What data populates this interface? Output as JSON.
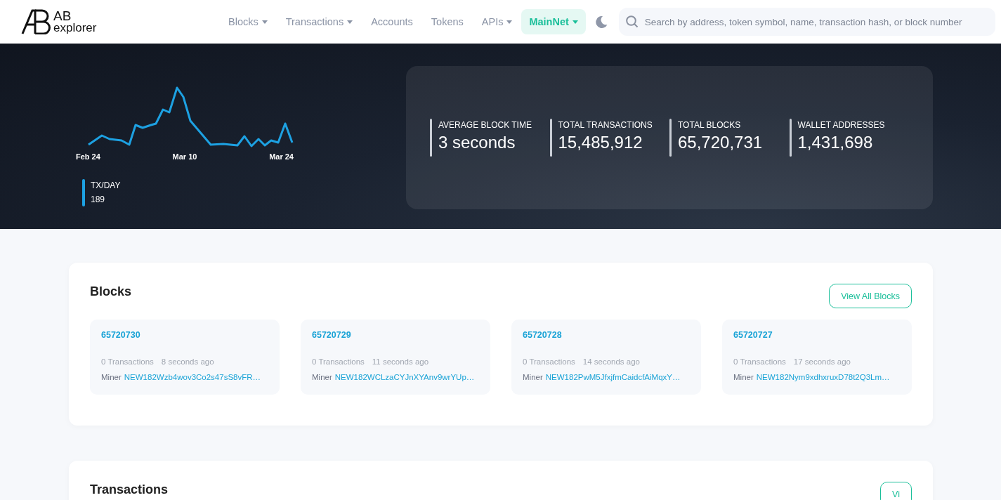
{
  "header": {
    "logo_title": "AB",
    "logo_subtitle": "explorer",
    "nav": [
      {
        "label": "Blocks",
        "dropdown": true,
        "selected": false
      },
      {
        "label": "Transactions",
        "dropdown": true,
        "selected": false
      },
      {
        "label": "Accounts",
        "dropdown": false,
        "selected": false
      },
      {
        "label": "Tokens",
        "dropdown": false,
        "selected": false
      },
      {
        "label": "APIs",
        "dropdown": true,
        "selected": false
      },
      {
        "label": "MainNet",
        "dropdown": true,
        "selected": true
      }
    ],
    "search": {
      "placeholder": "Search by address, token symbol, name, transaction hash, or block number"
    }
  },
  "hero": {
    "chart_x_labels": [
      "Feb 24",
      "Mar 10",
      "Mar 24"
    ],
    "legend": {
      "label": "TX/DAY",
      "value": "189"
    },
    "stats": [
      {
        "label": "AVERAGE BLOCK TIME",
        "value": "3 seconds"
      },
      {
        "label": "TOTAL TRANSACTIONS",
        "value": "15,485,912"
      },
      {
        "label": "TOTAL BLOCKS",
        "value": "65,720,731"
      },
      {
        "label": "WALLET ADDRESSES",
        "value": "1,431,698"
      }
    ]
  },
  "blocks": {
    "title": "Blocks",
    "button": "View All Blocks",
    "items": [
      {
        "number": "65720730",
        "transactions": "0 Transactions",
        "age": "8 seconds ago",
        "miner_label": "Miner",
        "miner": "NEW182Wzb4wov3Co2s47sS8vFR…"
      },
      {
        "number": "65720729",
        "transactions": "0 Transactions",
        "age": "11 seconds ago",
        "miner_label": "Miner",
        "miner": "NEW182WCLzaCYJnXYAnv9wrYUp…"
      },
      {
        "number": "65720728",
        "transactions": "0 Transactions",
        "age": "14 seconds ago",
        "miner_label": "Miner",
        "miner": "NEW182PwM5JfxjfmCaidcfAiMqxY…"
      },
      {
        "number": "65720727",
        "transactions": "0 Transactions",
        "age": "17 seconds ago",
        "miner_label": "Miner",
        "miner": "NEW182Nym9xdhxruxD78t2Q3Lm…"
      }
    ]
  },
  "transactions": {
    "title": "Transactions",
    "button": "Vi"
  }
}
